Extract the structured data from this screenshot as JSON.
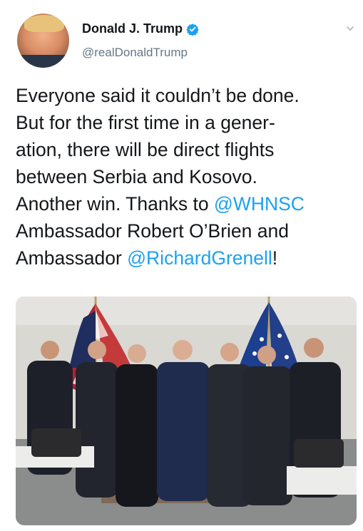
{
  "user": {
    "display_name": "Donald J. Trump",
    "handle": "@realDonaldTrump"
  },
  "icons": {
    "verified": "verified-badge-icon",
    "chevron": "chevron-down-icon"
  },
  "tweet": {
    "text_line1": "Everyone said it couldn’t be done.",
    "text_line2": "But for the first time in a gener-",
    "text_line3": "ation, there will be direct flights",
    "text_line4": "between Serbia and Kosovo.",
    "text_line5_prefix": "Another win. Thanks to ",
    "mention1": "@WHNSC",
    "text_line6": "Ambassador Robert O’Brien and",
    "text_line7_prefix": "Ambassador ",
    "mention2": "@RichardGrenell",
    "text_line7_suffix": "!"
  },
  "colors": {
    "accent": "#1da1f2",
    "text": "#14171a",
    "secondary": "#657786"
  }
}
